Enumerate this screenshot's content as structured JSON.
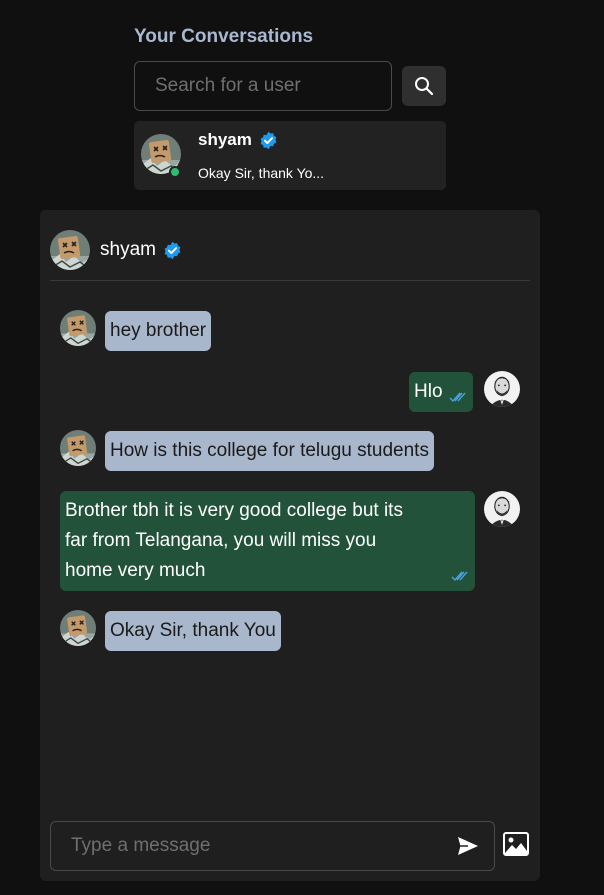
{
  "sidebar": {
    "title": "Your Conversations",
    "search": {
      "placeholder": "Search for a user",
      "value": ""
    },
    "conversations": [
      {
        "name": "shyam",
        "verified": true,
        "online": true,
        "last_message": "Okay Sir, thank Yo..."
      }
    ]
  },
  "chat": {
    "header": {
      "name": "shyam",
      "verified": true
    },
    "messages": [
      {
        "from": "them",
        "text": "hey brother"
      },
      {
        "from": "me",
        "text": "Hlo",
        "seen": true
      },
      {
        "from": "them",
        "text": "How is this college for telugu students"
      },
      {
        "from": "me",
        "lines": [
          "Brother tbh it is very good college but its",
          "far from Telangana, you will miss you",
          "home very much"
        ],
        "seen": true
      },
      {
        "from": "them",
        "text": "Okay Sir, thank You"
      }
    ],
    "composer": {
      "placeholder": "Type a message",
      "value": ""
    }
  },
  "icons": {
    "search": "search-icon",
    "verified": "verified-badge-icon",
    "seen": "double-check-icon",
    "send": "send-icon",
    "image": "image-icon"
  },
  "colors": {
    "background": "#101010",
    "panel": "#1f1f1f",
    "incoming_bubble": "#a9b7cc",
    "outgoing_bubble": "#225239",
    "accent_title": "#a9b7d0",
    "verified": "#1d9bf0",
    "seen_tick": "#4aa3df",
    "online": "#2fbd6f"
  }
}
